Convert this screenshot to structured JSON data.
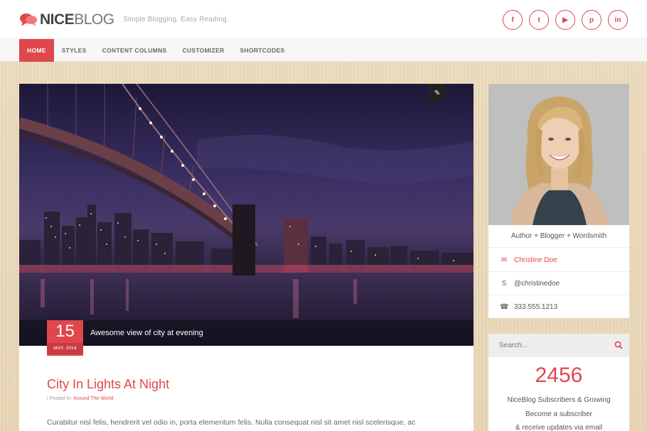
{
  "colors": {
    "accent": "#e0474c"
  },
  "header": {
    "logo_bold": "NICE",
    "logo_light": "BLOG",
    "tagline": "Simple Blogging. Easy Reading.",
    "social": [
      {
        "icon": "facebook-icon",
        "glyph": "f"
      },
      {
        "icon": "twitter-icon",
        "glyph": "t"
      },
      {
        "icon": "youtube-icon",
        "glyph": "▶"
      },
      {
        "icon": "pinterest-icon",
        "glyph": "p"
      },
      {
        "icon": "linkedin-icon",
        "glyph": "in"
      }
    ]
  },
  "nav": {
    "items": [
      "HOME",
      "STYLES",
      "CONTENT COLUMNS",
      "CUSTOMIZER",
      "SHORTCODES"
    ],
    "active": "HOME"
  },
  "post": {
    "caption": "Awesome view of city at evening",
    "date_day": "15",
    "date_month": "MAY, 2014",
    "title": "City In Lights At Night",
    "meta_prefix": "/ Posted In:",
    "category": "Around The World",
    "excerpt": "Curabitur nisl felis, hendrerit vel odio in, porta elementum felis. Nulla consequat nisl sit amet nisl scelerisque, ac"
  },
  "author": {
    "role": "Author + Blogger + Wordsmith",
    "name": "Christine Doe",
    "skype": "@christinedoe",
    "phone": "333.555.1213"
  },
  "subscribe": {
    "search_placeholder": "Search...",
    "count": "2456",
    "line1": "NiceBlog Subscribers & Growing",
    "line2": "Become a subscriber",
    "line3": "& receive updates via email"
  }
}
